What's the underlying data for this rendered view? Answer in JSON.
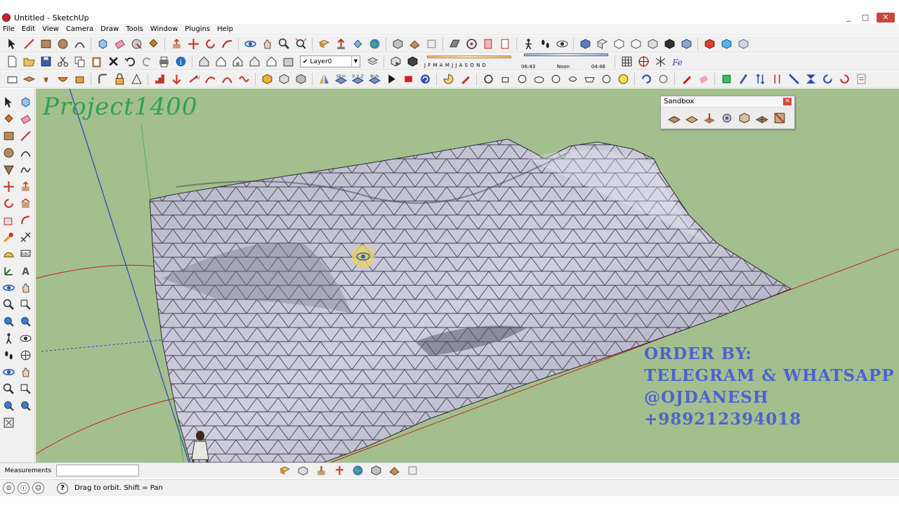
{
  "window": {
    "title": "Untitled - SketchUp",
    "minimize": "_",
    "maximize": "□",
    "close": "✕"
  },
  "menu": {
    "items": [
      "File",
      "Edit",
      "View",
      "Camera",
      "Draw",
      "Tools",
      "Window",
      "Plugins",
      "Help"
    ]
  },
  "toolbar": {
    "layer_value": "Layer0",
    "shadow_months": "J F M A M J J A S O N D",
    "shadow_times": {
      "start": "06:43",
      "mid": "Noon",
      "end": "04:46"
    },
    "sandbox_labels": {
      "skin": "Skin",
      "xyz": "X,Y,Z",
      "bub": "Bub"
    }
  },
  "viewport": {
    "background": "#a4bf8e",
    "watermark": "Project1400",
    "order_lines": [
      "ORDER BY:",
      "TELEGRAM & WHATSAPP",
      "@OJDANESH",
      "+989212394018"
    ],
    "order_color": "#4c62d1",
    "watermark_color": "#2fa24d"
  },
  "sandbox_panel": {
    "title": "Sandbox",
    "close": "✕",
    "tools": [
      "from-contours-icon",
      "from-scratch-icon",
      "smoove-icon",
      "stamp-icon",
      "drape-icon",
      "add-detail-icon",
      "flip-edge-icon"
    ]
  },
  "measurements": {
    "label": "Measurements",
    "value": ""
  },
  "status": {
    "help": "?",
    "text": "Drag to orbit.  Shift = Pan"
  }
}
